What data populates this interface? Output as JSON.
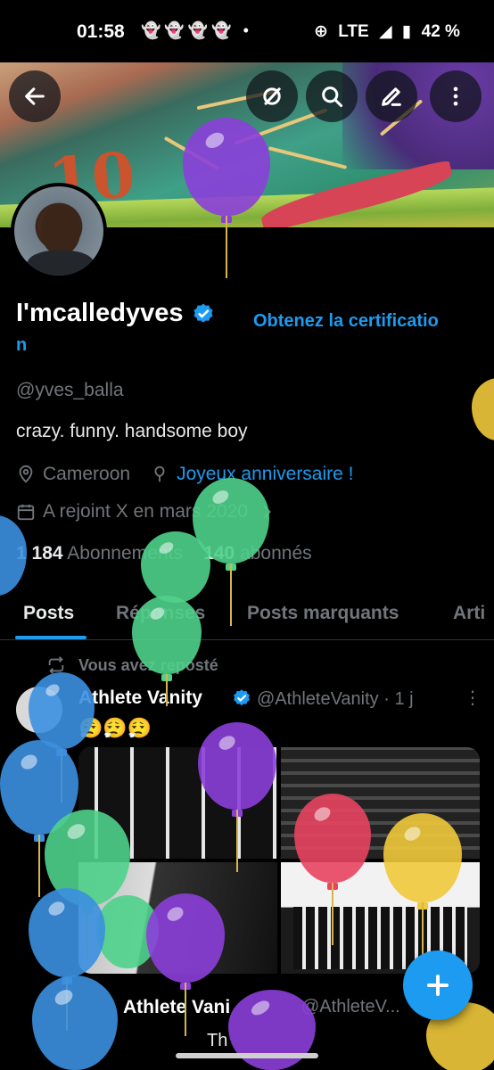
{
  "status_bar": {
    "time": "01:58",
    "notification_icons": "👻👻👻👻 •",
    "network": "LTE",
    "battery": "42 %"
  },
  "profile": {
    "display_name": "I'mcalledyves",
    "get_verified_line1": "Obtenez la certificatio",
    "get_verified_line2": "n",
    "handle": "@yves_balla",
    "bio": "crazy. funny.  handsome boy",
    "location": "Cameroon",
    "birthday_link": "Joyeux anniversaire !",
    "joined": "A rejoint X en mars 2020",
    "following_count": "1 184",
    "following_label": "Abonnements",
    "followers_count": "140",
    "followers_label": "abonnés"
  },
  "tabs": [
    "Posts",
    "Réponses",
    "Posts marquants",
    "Arti"
  ],
  "post": {
    "repost_label": "Vous avez reposté",
    "author": "Athlete Vanity",
    "handle_time": "@AthleteVanity · 1 j",
    "text": "😮‍💨😮‍💨😮‍💨",
    "quoted_author": "Athlete Vani",
    "quoted_handle": "@AthleteV...",
    "quoted_text": "Th"
  },
  "colors": {
    "accent": "#1d9bf0",
    "background": "#000000",
    "muted": "#71767b",
    "balloon_purple": "#8b3fd9",
    "balloon_green": "#4fd18b",
    "balloon_blue": "#3b8fe0",
    "balloon_red": "#e8445f",
    "balloon_yellow": "#f0c93a"
  },
  "icons": {
    "back": "arrow-left-icon",
    "grok": "grok-icon",
    "search": "search-icon",
    "edit": "edit-icon",
    "more": "more-vertical-icon",
    "fab": "plus-icon"
  }
}
